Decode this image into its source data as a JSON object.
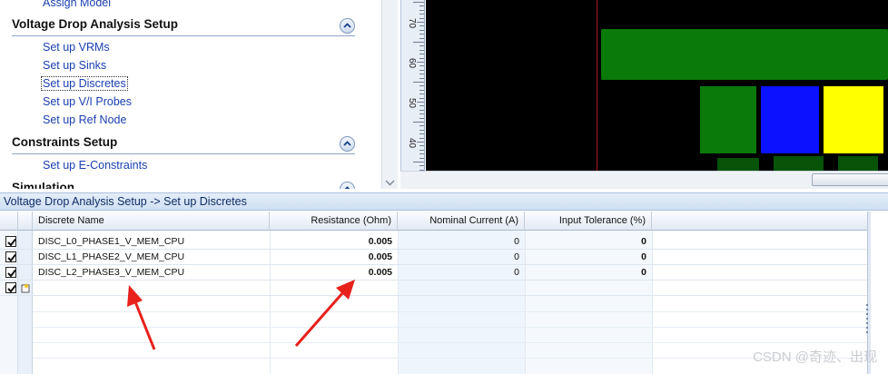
{
  "workflow": {
    "partial_top_item": "Assign Model",
    "sections": [
      {
        "title": "Voltage Drop Analysis Setup",
        "items": [
          "Set up VRMs",
          "Set up Sinks",
          "Set up Discretes",
          "Set up V/I Probes",
          "Set up Ref Node"
        ],
        "selected": "Set up Discretes"
      },
      {
        "title": "Constraints Setup",
        "items": [
          "Set up E-Constraints"
        ]
      },
      {
        "title": "Simulation"
      }
    ]
  },
  "ruler": {
    "labels": [
      "70",
      "60",
      "50",
      "40"
    ]
  },
  "canvas": {
    "colors": {
      "background": "#000000",
      "green": "#0a7a0a",
      "dark_green": "#075307",
      "blue": "#0a12ff",
      "yellow": "#ffff00",
      "marker_line": "#b21414"
    }
  },
  "panel": {
    "breadcrumb": "Voltage Drop Analysis Setup -> Set up Discretes"
  },
  "grid": {
    "columns": [
      "Discrete Name",
      "Resistance (Ohm)",
      "Nominal Current (A)",
      "Input Tolerance (%)"
    ],
    "rows": [
      {
        "checked": true,
        "name": "DISC_L0_PHASE1_V_MEM_CPU",
        "resistance": "0.005",
        "current": "0",
        "tolerance": "0"
      },
      {
        "checked": true,
        "name": "DISC_L1_PHASE2_V_MEM_CPU",
        "resistance": "0.005",
        "current": "0",
        "tolerance": "0"
      },
      {
        "checked": true,
        "name": "DISC_L2_PHASE3_V_MEM_CPU",
        "resistance": "0.005",
        "current": "0",
        "tolerance": "0"
      }
    ],
    "new_row_checked": true
  },
  "annotation": {
    "arrow_color": "#e8211c"
  },
  "watermark": "CSDN @奇迹、出现"
}
